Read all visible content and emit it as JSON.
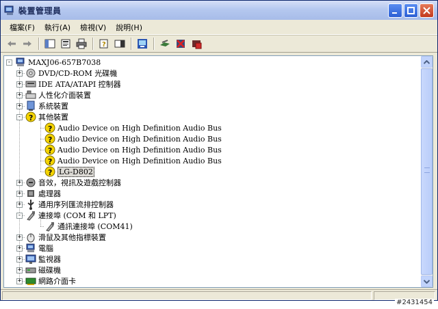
{
  "window": {
    "title": "裝置管理員"
  },
  "menu": [
    "檔案(F)",
    "執行(A)",
    "檢視(V)",
    "說明(H)"
  ],
  "toolbar": [
    {
      "name": "back-arrow-icon"
    },
    {
      "name": "forward-arrow-icon"
    },
    {
      "name": "console-tree-icon"
    },
    {
      "name": "properties-icon"
    },
    {
      "name": "print-icon"
    },
    {
      "name": "help-icon"
    },
    {
      "name": "show-hide-icon"
    },
    {
      "name": "scan-hardware-icon"
    },
    {
      "name": "update-driver-icon"
    },
    {
      "name": "uninstall-icon"
    },
    {
      "name": "disable-icon"
    }
  ],
  "tree": [
    {
      "label": "MAXJ06-657B7038",
      "level": 0,
      "exp": "-",
      "icon": "computer",
      "name": "tree-node-computer"
    },
    {
      "label": "DVD/CD-ROM 光碟機",
      "level": 1,
      "exp": "+",
      "icon": "cdrom",
      "name": "tree-node-dvd-cdrom"
    },
    {
      "label": "IDE ATA/ATAPI 控制器",
      "level": 1,
      "exp": "+",
      "icon": "ide",
      "name": "tree-node-ide"
    },
    {
      "label": "人性化介面裝置",
      "level": 1,
      "exp": "+",
      "icon": "hid",
      "name": "tree-node-hid"
    },
    {
      "label": "系統裝置",
      "level": 1,
      "exp": "+",
      "icon": "system",
      "name": "tree-node-system-devices"
    },
    {
      "label": "其他裝置",
      "level": 1,
      "exp": "-",
      "icon": "unknown",
      "name": "tree-node-other-devices"
    },
    {
      "label": "Audio Device on High Definition Audio Bus",
      "level": 2,
      "icon": "unknown",
      "name": "tree-node-audio-device-1"
    },
    {
      "label": "Audio Device on High Definition Audio Bus",
      "level": 2,
      "icon": "unknown",
      "name": "tree-node-audio-device-2"
    },
    {
      "label": "Audio Device on High Definition Audio Bus",
      "level": 2,
      "icon": "unknown",
      "name": "tree-node-audio-device-3"
    },
    {
      "label": "Audio Device on High Definition Audio Bus",
      "level": 2,
      "icon": "unknown",
      "name": "tree-node-audio-device-4"
    },
    {
      "label": "LG-D802",
      "level": 2,
      "icon": "unknown",
      "selected": true,
      "name": "tree-node-lg-d802"
    },
    {
      "label": "音效，視訊及遊戲控制器",
      "level": 1,
      "exp": "+",
      "icon": "sound",
      "name": "tree-node-sound"
    },
    {
      "label": "處理器",
      "level": 1,
      "exp": "+",
      "icon": "cpu",
      "name": "tree-node-processors"
    },
    {
      "label": "通用序列匯流排控制器",
      "level": 1,
      "exp": "+",
      "icon": "usb",
      "name": "tree-node-usb"
    },
    {
      "label": "連接埠 (COM 和 LPT)",
      "level": 1,
      "exp": "-",
      "icon": "port",
      "name": "tree-node-ports"
    },
    {
      "label": "通訊連接埠 (COM41)",
      "level": 2,
      "icon": "port",
      "name": "tree-node-com41"
    },
    {
      "label": "滑鼠及其他指標裝置",
      "level": 1,
      "exp": "+",
      "icon": "mouse",
      "name": "tree-node-mouse"
    },
    {
      "label": "電腦",
      "level": 1,
      "exp": "+",
      "icon": "computer",
      "name": "tree-node-computer-class"
    },
    {
      "label": "監視器",
      "level": 1,
      "exp": "+",
      "icon": "monitor",
      "name": "tree-node-monitors"
    },
    {
      "label": "磁碟機",
      "level": 1,
      "exp": "+",
      "icon": "disk",
      "name": "tree-node-disk-drives"
    },
    {
      "label": "網路介面卡",
      "level": 1,
      "exp": "+",
      "icon": "network",
      "name": "tree-node-network"
    }
  ],
  "watermark": "#2431454"
}
